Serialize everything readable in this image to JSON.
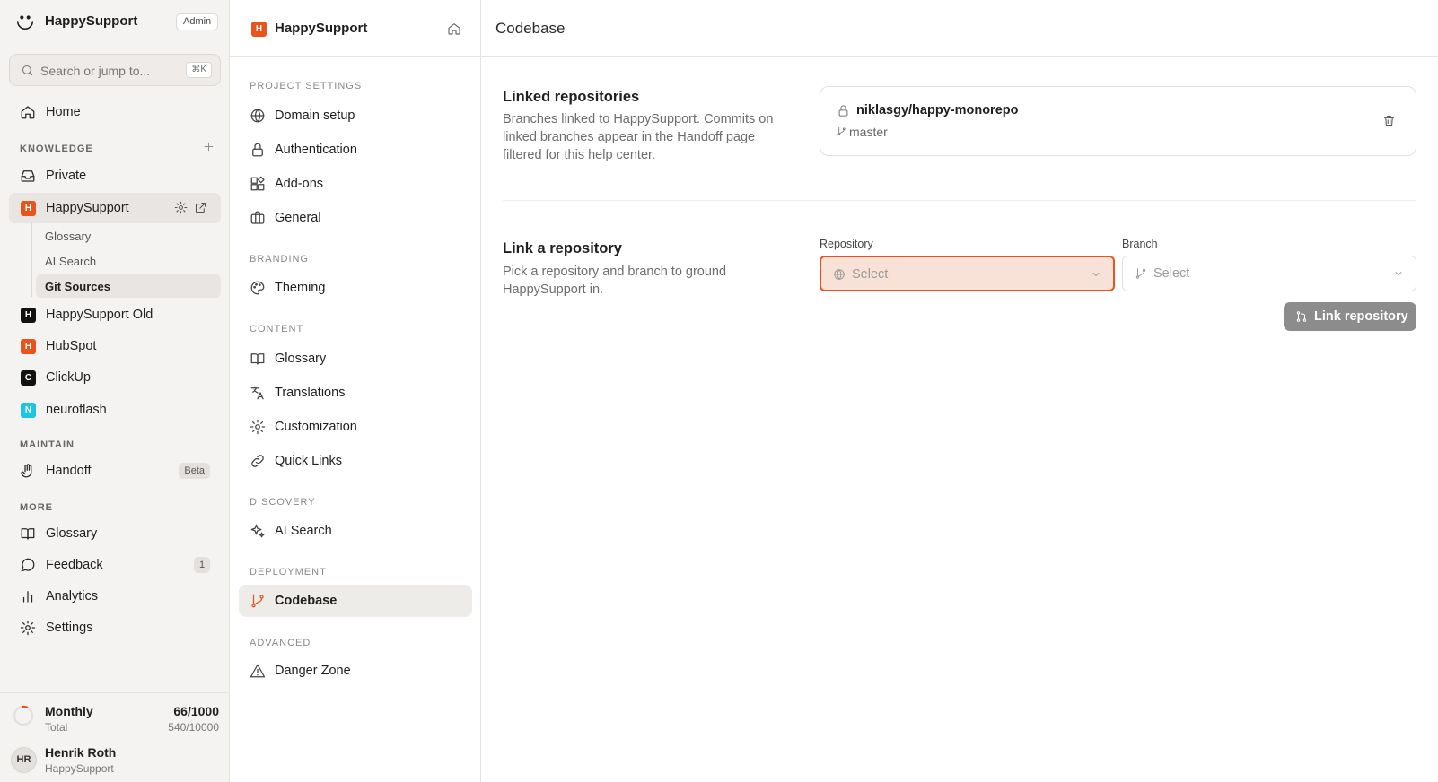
{
  "sidebar": {
    "brand": "HappySupport",
    "role_badge": "Admin",
    "search": {
      "placeholder": "Search or jump to...",
      "shortcut": "⌘K"
    },
    "home": "Home",
    "knowledge": {
      "heading": "KNOWLEDGE",
      "private": "Private",
      "happysupport": {
        "label": "HappySupport",
        "initial": "H",
        "color": "#e8541c"
      },
      "sub_items": [
        "Glossary",
        "AI Search",
        "Git Sources"
      ],
      "projects": [
        {
          "label": "HappySupport Old",
          "initial": "H",
          "color": "#111111"
        },
        {
          "label": "HubSpot",
          "initial": "H",
          "color": "#e8541c"
        },
        {
          "label": "ClickUp",
          "initial": "C",
          "color": "#111111"
        },
        {
          "label": "neuroflash",
          "initial": "N",
          "color": "#1cc6e0"
        }
      ]
    },
    "maintain": {
      "heading": "MAINTAIN",
      "handoff": "Handoff",
      "handoff_badge": "Beta"
    },
    "more": {
      "heading": "MORE",
      "glossary": "Glossary",
      "feedback": "Feedback",
      "feedback_count": "1",
      "analytics": "Analytics",
      "settings": "Settings"
    },
    "usage": {
      "title": "Monthly",
      "subtitle": "Total",
      "value": "66/1000",
      "total": "540/10000",
      "fraction": 0.066
    },
    "user": {
      "initials": "HR",
      "name": "Henrik Roth",
      "org": "HappySupport"
    }
  },
  "settings_nav": {
    "title": "HappySupport",
    "initial": "H",
    "sections": {
      "project": "PROJECT SETTINGS",
      "branding": "BRANDING",
      "content": "CONTENT",
      "discovery": "DISCOVERY",
      "deployment": "DEPLOYMENT",
      "advanced": "ADVANCED"
    },
    "items": {
      "domain": "Domain setup",
      "auth": "Authentication",
      "addons": "Add-ons",
      "general": "General",
      "theming": "Theming",
      "glossary": "Glossary",
      "translations": "Translations",
      "customization": "Customization",
      "quicklinks": "Quick Links",
      "aisearch": "AI Search",
      "codebase": "Codebase",
      "danger": "Danger Zone"
    }
  },
  "main": {
    "title": "Codebase",
    "linked": {
      "title": "Linked repositories",
      "description": "Branches linked to HappySupport. Commits on linked branches appear in the Handoff page filtered for this help center.",
      "repo": {
        "name": "niklasgy/happy-monorepo",
        "branch": "master"
      }
    },
    "link": {
      "title": "Link a repository",
      "description": "Pick a repository and branch to ground HappySupport in.",
      "repository_label": "Repository",
      "repository_placeholder": "Select",
      "branch_label": "Branch",
      "branch_placeholder": "Select",
      "button": "Link repository"
    }
  },
  "colors": {
    "accent": "#e8541c",
    "sidebar_bg": "#f5f3f1",
    "focus_fill": "#f8e1d6",
    "button_disabled": "#8c8c8c"
  }
}
